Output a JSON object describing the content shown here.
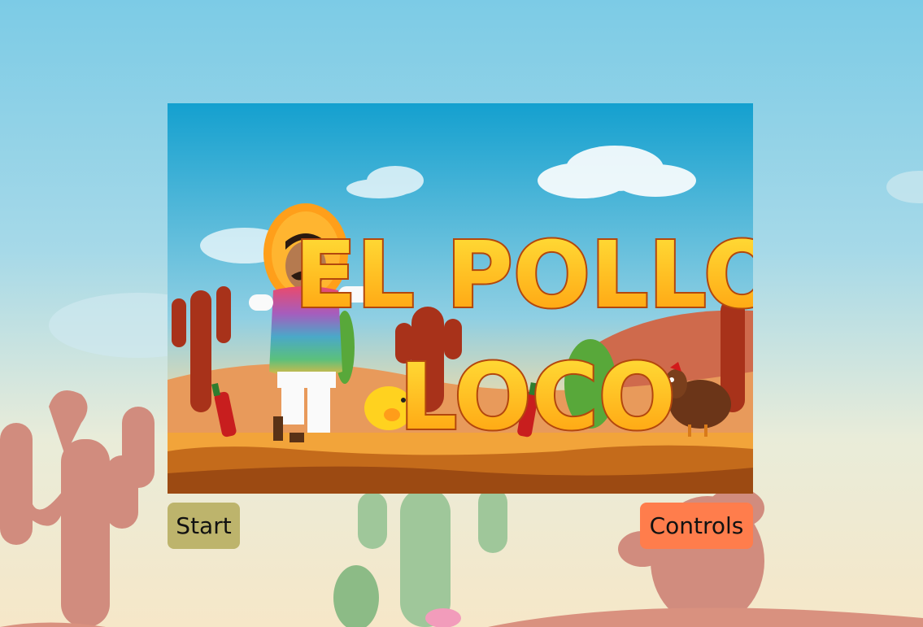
{
  "game": {
    "title_line1": "EL POLLO",
    "title_line2": "LOCO"
  },
  "buttons": {
    "start_label": "Start",
    "controls_label": "Controls"
  },
  "colors": {
    "sky_top": "#7ccbe6",
    "sand": "#f6e7c8",
    "start_button": "#bdb46c",
    "controls_button": "#ff7d4c",
    "title_fill": "#ffc21a",
    "title_outline": "#b3470d"
  }
}
